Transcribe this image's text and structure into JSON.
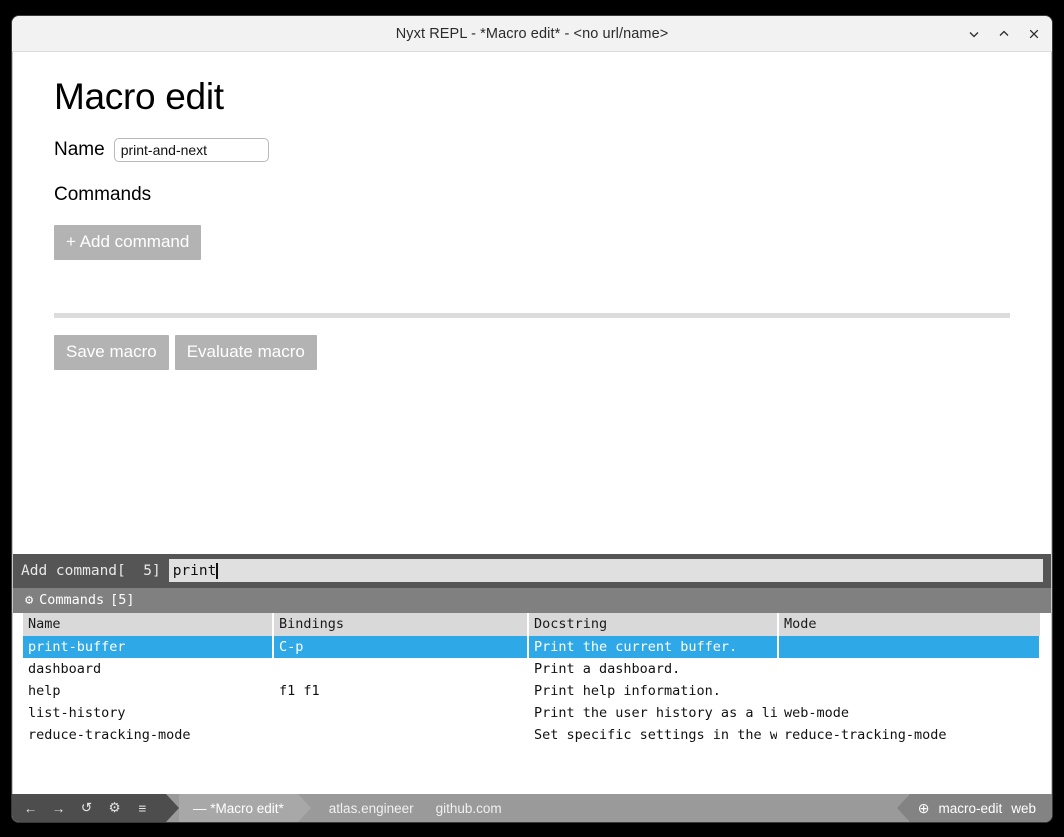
{
  "window": {
    "title": "Nyxt REPL - *Macro edit* - <no url/name>",
    "controls": [
      {
        "name": "minimize",
        "glyph": "minimize-icon"
      },
      {
        "name": "maximize",
        "glyph": "maximize-icon"
      },
      {
        "name": "close",
        "glyph": "close-icon"
      }
    ]
  },
  "page": {
    "heading": "Macro edit",
    "name_label": "Name",
    "name_value": "print-and-next",
    "name_placeholder": "",
    "commands_label": "Commands",
    "add_command_label": "+ Add command",
    "save_macro_label": "Save macro",
    "evaluate_macro_label": "Evaluate macro"
  },
  "prompt": {
    "label": "Add command[  5]",
    "input_value": "print"
  },
  "suggestions": {
    "icon": "gear-icon",
    "header_title": "Commands",
    "header_count": "[5]",
    "columns": [
      "Name",
      "Bindings",
      "Docstring",
      "Mode"
    ],
    "rows": [
      {
        "name": "print-buffer",
        "bindings": "C-p",
        "docstring": "Print the current buffer.",
        "mode": "",
        "selected": true
      },
      {
        "name": "dashboard",
        "bindings": "",
        "docstring": "Print a dashboard.",
        "mode": "",
        "selected": false
      },
      {
        "name": "help",
        "bindings": "f1 f1",
        "docstring": "Print help information.",
        "mode": "",
        "selected": false
      },
      {
        "name": "list-history",
        "bindings": "",
        "docstring": "Print the user history as a list.",
        "mode": "web-mode",
        "selected": false
      },
      {
        "name": "reduce-tracking-mode",
        "bindings": "",
        "docstring": "Set specific settings in the web buffer.",
        "mode": "reduce-tracking-mode",
        "selected": false
      }
    ]
  },
  "statusbar": {
    "icons": [
      {
        "name": "back-icon",
        "glyph": "←"
      },
      {
        "name": "forward-icon",
        "glyph": "→"
      },
      {
        "name": "reload-icon",
        "glyph": "↺"
      },
      {
        "name": "gear-icon",
        "glyph": "⚙"
      },
      {
        "name": "menu-icon",
        "glyph": "≡"
      }
    ],
    "buffer_label": "— *Macro edit*",
    "urls": [
      "atlas.engineer",
      "github.com"
    ],
    "mode_icon": "⊕",
    "modes": [
      "macro-edit",
      "web"
    ]
  },
  "colors": {
    "accent_selected": "#2fa8e8",
    "button_gray": "#b3b3b3",
    "prompt_bg": "#555555",
    "header_gray": "#808080"
  }
}
